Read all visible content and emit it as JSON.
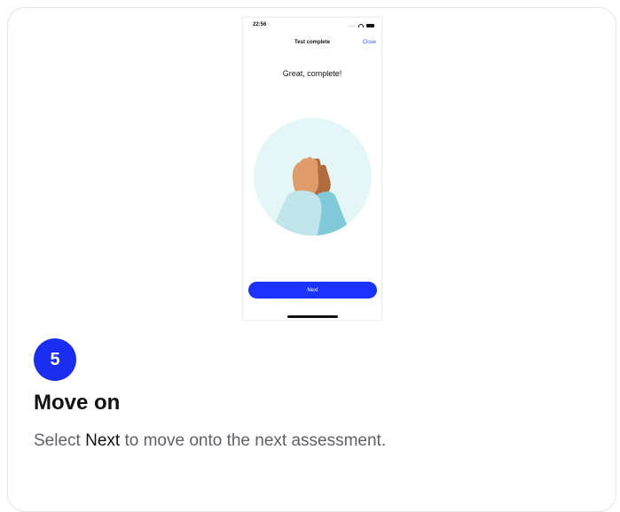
{
  "phone": {
    "status_time": "22:56",
    "signal": "....",
    "nav_title": "Test complete",
    "nav_close": "Close",
    "headline": "Great, complete!",
    "next_button": "Next",
    "illustration_icon": "high-five-icon"
  },
  "step": {
    "number": "5",
    "title": "Move on",
    "desc_prefix": "Select ",
    "desc_highlight": "Next",
    "desc_suffix": " to move onto the next assessment."
  },
  "colors": {
    "accent": "#1a2ef2",
    "button": "#1a33ff",
    "close_link": "#2f55ff",
    "illustration_bg": "#e3f7f6"
  }
}
